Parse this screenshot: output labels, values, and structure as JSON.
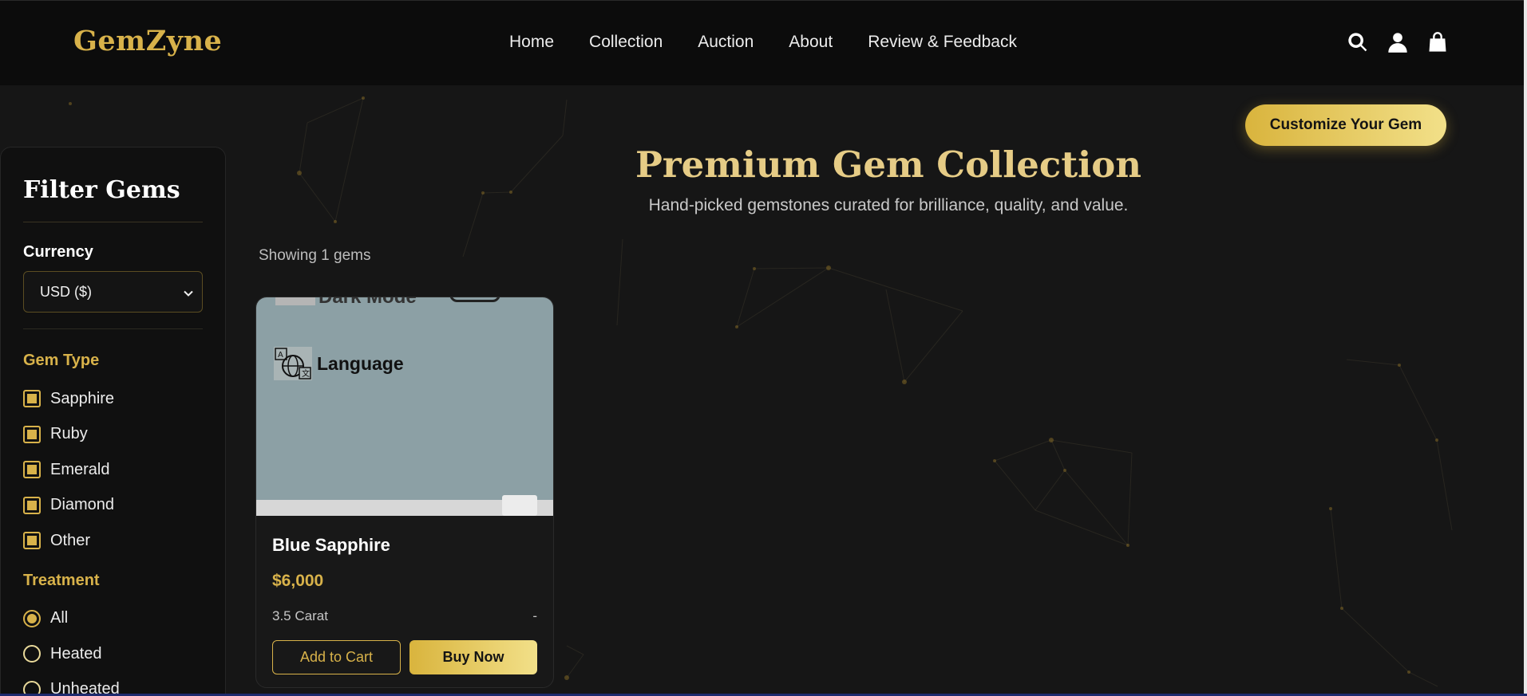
{
  "brand": {
    "name": "GemZyne"
  },
  "nav": {
    "links": [
      "Home",
      "Collection",
      "Auction",
      "About",
      "Review & Feedback"
    ],
    "icons": [
      "search-icon",
      "user-icon",
      "shopping-bag-icon"
    ]
  },
  "hero": {
    "cta_label": "Customize Your Gem",
    "title": "Premium Gem Collection",
    "subtitle": "Hand-picked gemstones curated for brilliance, quality, and value."
  },
  "filters": {
    "title": "Filter Gems",
    "currency": {
      "label": "Currency",
      "selected": "USD ($)"
    },
    "gem_type": {
      "label": "Gem Type",
      "options": [
        "Sapphire",
        "Ruby",
        "Emerald",
        "Diamond",
        "Other"
      ],
      "checked": [
        true,
        true,
        true,
        true,
        true
      ]
    },
    "treatment": {
      "label": "Treatment",
      "options": [
        "All",
        "Heated",
        "Unheated"
      ],
      "selected": "All"
    }
  },
  "results": {
    "showing_text": "Showing 1 gems"
  },
  "products": [
    {
      "image_text": {
        "top": "Dark Mode",
        "main": "Language"
      },
      "name": "Blue Sapphire",
      "price": "$6,000",
      "weight": "3.5 Carat",
      "origin": "-",
      "add_to_cart_label": "Add to Cart",
      "buy_now_label": "Buy Now"
    }
  ],
  "colors": {
    "accent_gold": "#d8b24a",
    "title_gold": "#e6cc86",
    "background": "#161616",
    "navbar": "#0c0c0c"
  }
}
